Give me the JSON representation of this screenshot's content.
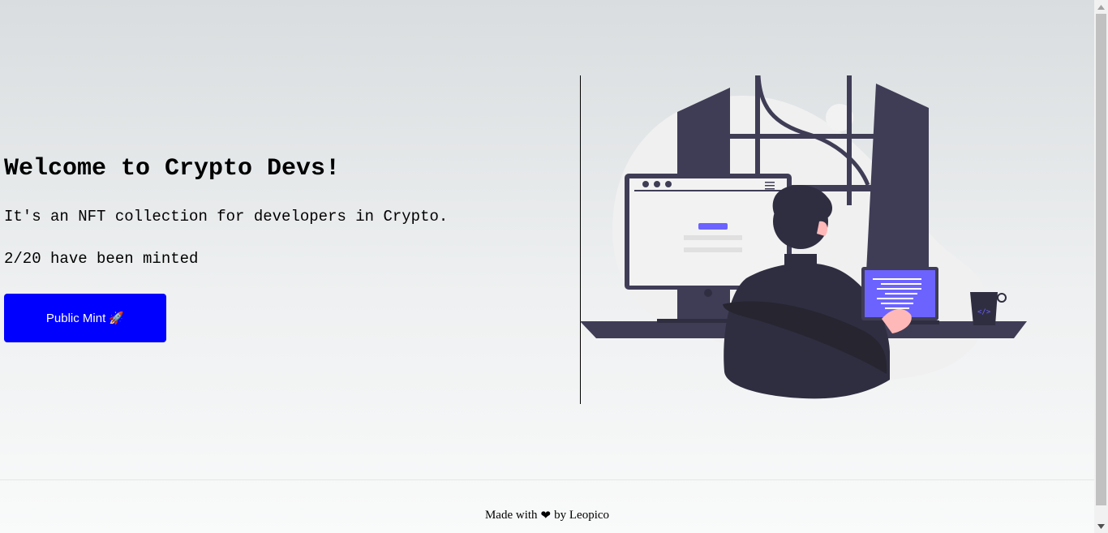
{
  "hero": {
    "title": "Welcome to Crypto Devs!",
    "description": "It's an NFT collection for developers in Crypto.",
    "minted_text": "2/20 have been minted",
    "mint_button_label": "Public Mint 🚀"
  },
  "illustration": {
    "name": "developer-at-desk-illustration"
  },
  "footer": {
    "prefix": "Made with",
    "heart": "❤",
    "suffix": "by Leopico"
  },
  "colors": {
    "button": "#0000ff",
    "illustration_dark": "#3f3d56",
    "illustration_accent": "#6c63ff"
  }
}
